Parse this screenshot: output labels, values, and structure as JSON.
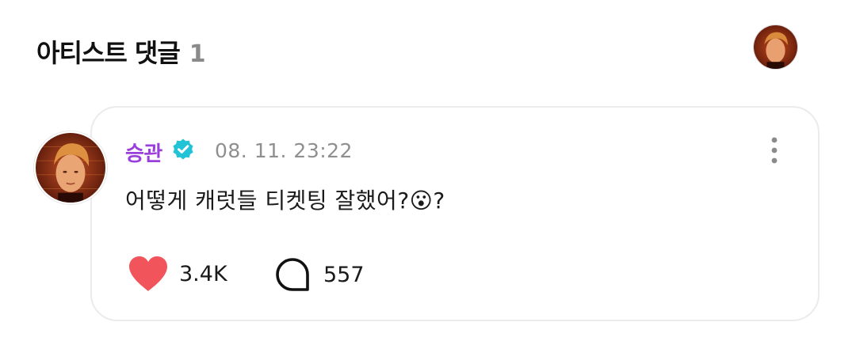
{
  "header": {
    "title": "아티스트 댓글",
    "count": "1",
    "avatar_icon": "artist-avatar"
  },
  "comment": {
    "author": "승관",
    "verified_icon": "verified-badge-icon",
    "timestamp": "08. 11. 23:22",
    "text": "어떻게 캐럿들 티켓팅 잘했어?😮?",
    "likes": "3.4K",
    "replies": "557",
    "more_icon": "more-vertical-icon",
    "like_icon": "heart-icon",
    "reply_icon": "speech-bubble-icon"
  },
  "colors": {
    "author": "#9a3fdc",
    "verified": "#22c3d6",
    "heart": "#f2545b",
    "timestamp": "#8f8f8f",
    "card_border": "#eceaea"
  }
}
